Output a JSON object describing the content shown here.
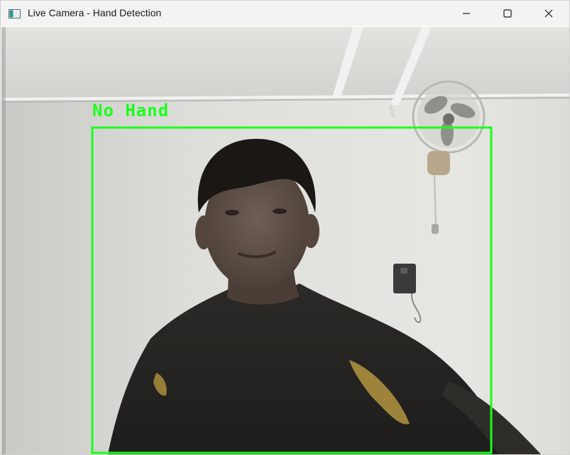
{
  "window": {
    "title": "Live Camera - Hand Detection",
    "icons": {
      "app": "app-window-icon",
      "minimize": "minimize-icon",
      "maximize": "maximize-icon",
      "close": "close-icon"
    }
  },
  "detection": {
    "label": "No Hand",
    "box_color": "#1aff1a"
  },
  "colors": {
    "titlebar": "#f3f3f3",
    "wall": "#dcdcd8",
    "shirt": "#262522",
    "accent_green": "#1aff1a"
  }
}
